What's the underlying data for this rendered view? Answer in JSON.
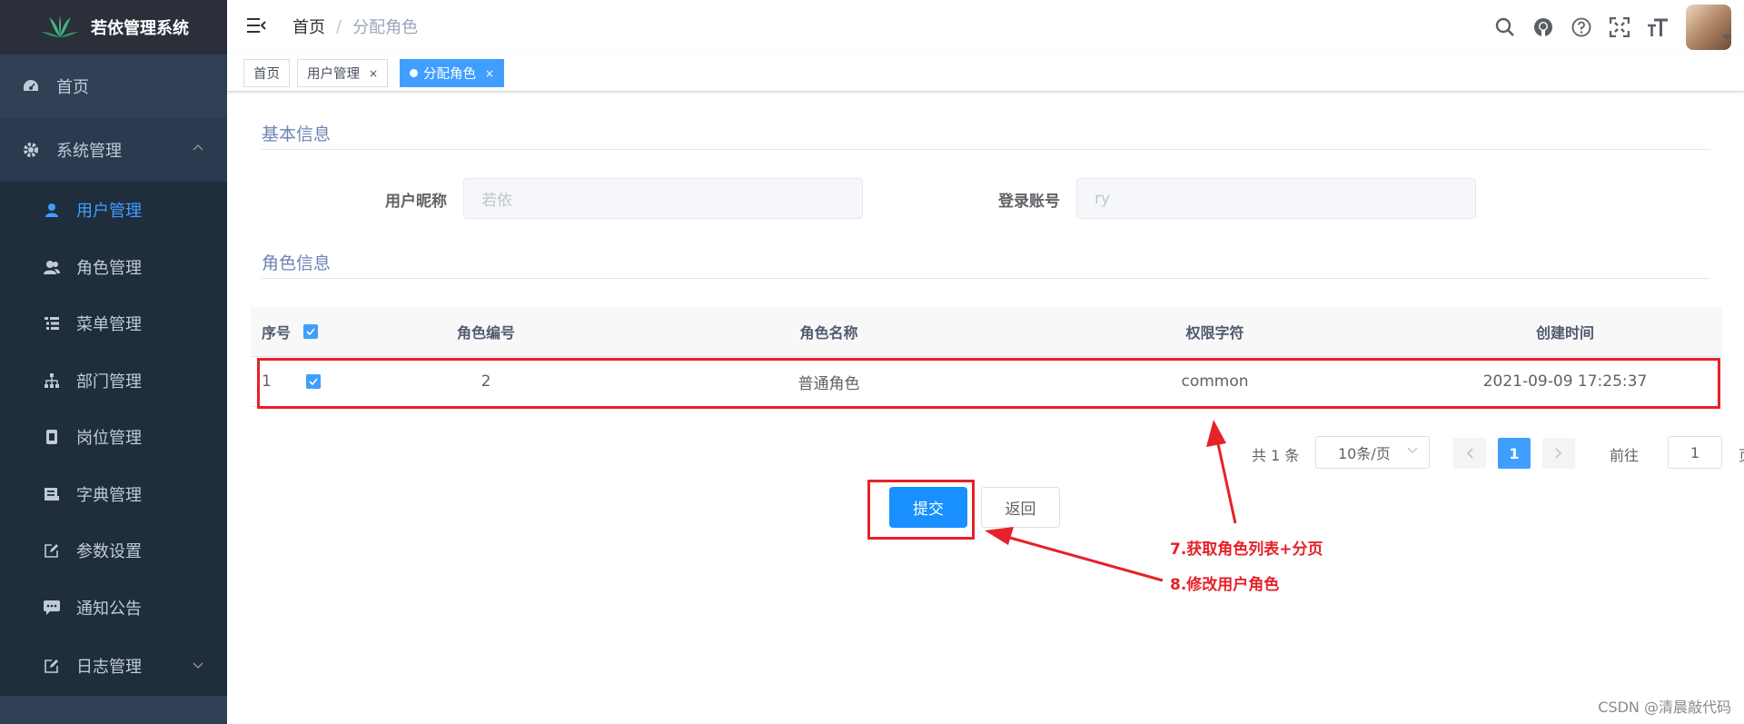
{
  "app": {
    "title": "若依管理系统"
  },
  "sidebar": {
    "home": "首页",
    "system": "系统管理",
    "items": [
      {
        "label": "用户管理",
        "icon": "user-icon",
        "active": true
      },
      {
        "label": "角色管理",
        "icon": "peoples-icon"
      },
      {
        "label": "菜单管理",
        "icon": "tree-table-icon"
      },
      {
        "label": "部门管理",
        "icon": "tree-icon"
      },
      {
        "label": "岗位管理",
        "icon": "post-icon"
      },
      {
        "label": "字典管理",
        "icon": "dict-icon"
      },
      {
        "label": "参数设置",
        "icon": "edit-icon"
      },
      {
        "label": "通知公告",
        "icon": "message-icon"
      }
    ],
    "log": "日志管理"
  },
  "navbar": {
    "breadcrumb_home": "首页",
    "breadcrumb_sep": "/",
    "breadcrumb_current": "分配角色"
  },
  "tags": [
    {
      "label": "首页"
    },
    {
      "label": "用户管理",
      "close": "×"
    },
    {
      "label": "分配角色",
      "close": "×",
      "active": true
    }
  ],
  "basic": {
    "title": "基本信息",
    "nickname_label": "用户昵称",
    "nickname_value": "若依",
    "account_label": "登录账号",
    "account_value": "ry"
  },
  "role": {
    "title": "角色信息",
    "columns": [
      "序号",
      "角色编号",
      "角色名称",
      "权限字符",
      "创建时间"
    ],
    "rows": [
      {
        "index": "1",
        "code": "2",
        "name": "普通角色",
        "key": "common",
        "time": "2021-09-09 17:25:37"
      }
    ]
  },
  "pagination": {
    "total": "共 1 条",
    "page_size": "10条/页",
    "current": "1",
    "goto": "前往",
    "goto_value": "1",
    "page": "页"
  },
  "buttons": {
    "submit": "提交",
    "back": "返回"
  },
  "annotations": {
    "a7": "7.获取角色列表+分页",
    "a8": "8.修改用户角色"
  },
  "watermark": "CSDN @清晨敲代码",
  "colors": {
    "primary": "#409eff",
    "sidebar_bg": "#304156",
    "annotation": "#e62129"
  }
}
